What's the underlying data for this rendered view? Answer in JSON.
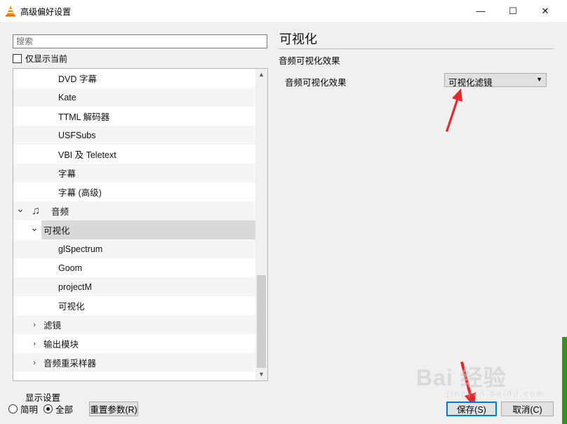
{
  "window": {
    "title": "高级偏好设置",
    "minimize_glyph": "—",
    "maximize_glyph": "☐",
    "close_glyph": "✕"
  },
  "left": {
    "search_placeholder": "搜索",
    "only_current_label": "仅显示当前",
    "tree": [
      {
        "label": "DVD 字幕",
        "level": 2
      },
      {
        "label": "Kate",
        "level": 2
      },
      {
        "label": "TTML 解码器",
        "level": 2
      },
      {
        "label": "USFSubs",
        "level": 2
      },
      {
        "label": "VBI 及 Teletext",
        "level": 2
      },
      {
        "label": "字幕",
        "level": 2
      },
      {
        "label": "字幕 (高级)",
        "level": 2
      },
      {
        "label": "音频",
        "level": 0,
        "expanded": true,
        "icon": "music-note-icon"
      },
      {
        "label": "可视化",
        "level": 1,
        "expanded": true,
        "selected": true
      },
      {
        "label": "glSpectrum",
        "level": 2
      },
      {
        "label": "Goom",
        "level": 2
      },
      {
        "label": "projectM",
        "level": 2
      },
      {
        "label": "可视化",
        "level": 2
      },
      {
        "label": "滤镜",
        "level": 1,
        "expanded": false
      },
      {
        "label": "输出模块",
        "level": 1,
        "expanded": false
      },
      {
        "label": "音频重采样器",
        "level": 1,
        "expanded": false
      }
    ]
  },
  "right": {
    "title": "可视化",
    "section": "音频可视化效果",
    "field_label": "音频可视化效果",
    "field_value": "可视化滤镜"
  },
  "footer": {
    "display_group": "显示设置",
    "simple_label": "简明",
    "all_label": "全部",
    "reset_label": "重置参数(R)",
    "save_label": "保存(S)",
    "cancel_label": "取消(C)"
  },
  "watermark": {
    "text": "Bai 经验",
    "sub": "jingyan.baidu.com"
  },
  "colors": {
    "accent": "#0078d7",
    "annotation_arrow": "#e8262b",
    "selection": "#d9d9d9"
  }
}
